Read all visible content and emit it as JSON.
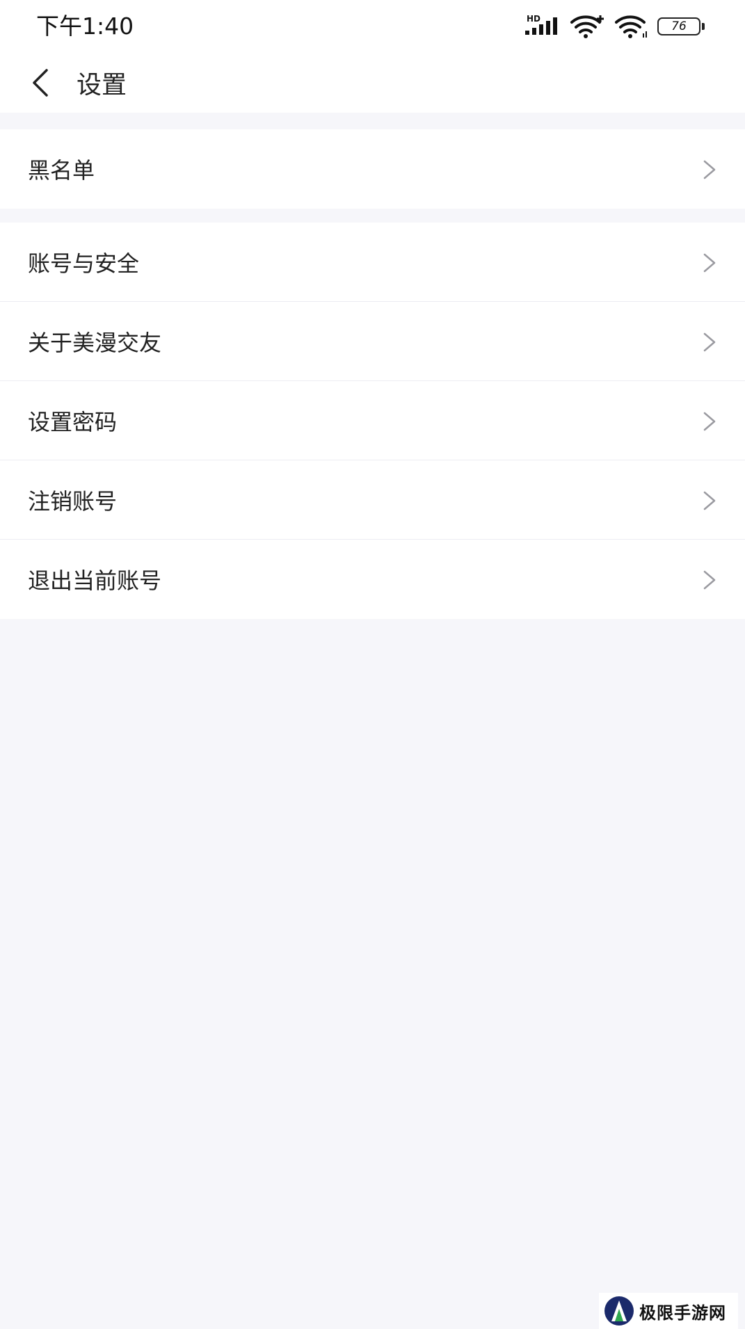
{
  "status_bar": {
    "time": "下午1:40",
    "network_label": "HD",
    "battery_level": "76",
    "icons": [
      "signal-icon",
      "wifi-plus-icon",
      "wifi-icon",
      "battery-icon"
    ]
  },
  "nav": {
    "title": "设置",
    "back_icon": "chevron-left-icon"
  },
  "groups": [
    {
      "items": [
        {
          "label": "黑名单"
        }
      ]
    },
    {
      "items": [
        {
          "label": "账号与安全"
        },
        {
          "label": "关于美漫交友"
        },
        {
          "label": "设置密码"
        },
        {
          "label": "注销账号"
        },
        {
          "label": "退出当前账号"
        }
      ]
    }
  ],
  "watermark": {
    "text": "极限手游网"
  },
  "colors": {
    "page_background": "#f6f6fa",
    "row_background": "#ffffff",
    "text": "#222222",
    "chevron": "#9a9aa0",
    "divider": "#ececf2"
  }
}
